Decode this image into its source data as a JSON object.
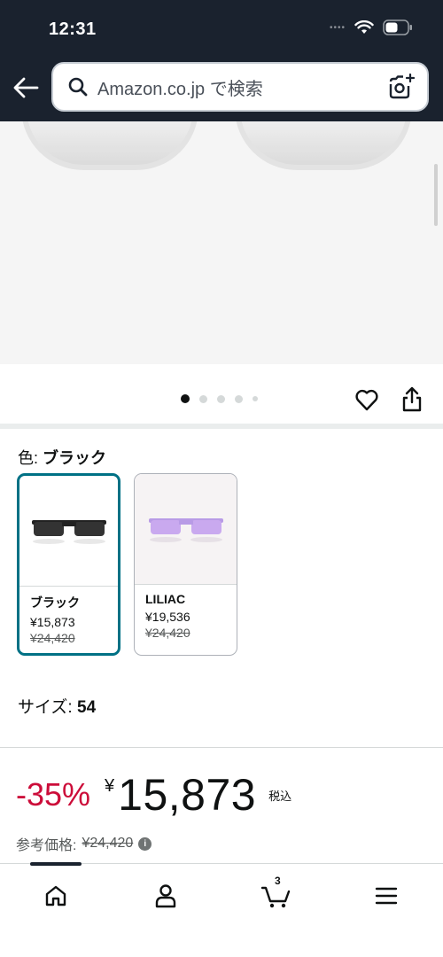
{
  "status": {
    "time": "12:31",
    "signal": "••••"
  },
  "search": {
    "placeholder": "Amazon.co.jp で検索"
  },
  "gallery": {
    "image_count": 5,
    "active_index": 0
  },
  "color": {
    "label": "色: ",
    "selected": "ブラック",
    "options": [
      {
        "name": "ブラック",
        "price": "¥15,873",
        "list_price": "¥24,420",
        "selected": true,
        "lens_color": "#3b3b3b"
      },
      {
        "name": "LILIAC",
        "price": "¥19,536",
        "list_price": "¥24,420",
        "selected": false,
        "lens_color": "#c9a9ef"
      }
    ]
  },
  "size": {
    "label": "サイズ: ",
    "value": "54"
  },
  "price": {
    "discount": "-35%",
    "currency": "¥",
    "amount": "15,873",
    "tax_note": "税込",
    "reference_label": "参考価格:",
    "reference_value": "¥24,420"
  },
  "nav": {
    "cart_count": "3"
  },
  "colors": {
    "header_bg": "#1a222e",
    "accent_teal": "#007185",
    "discount_red": "#cc0c39"
  }
}
